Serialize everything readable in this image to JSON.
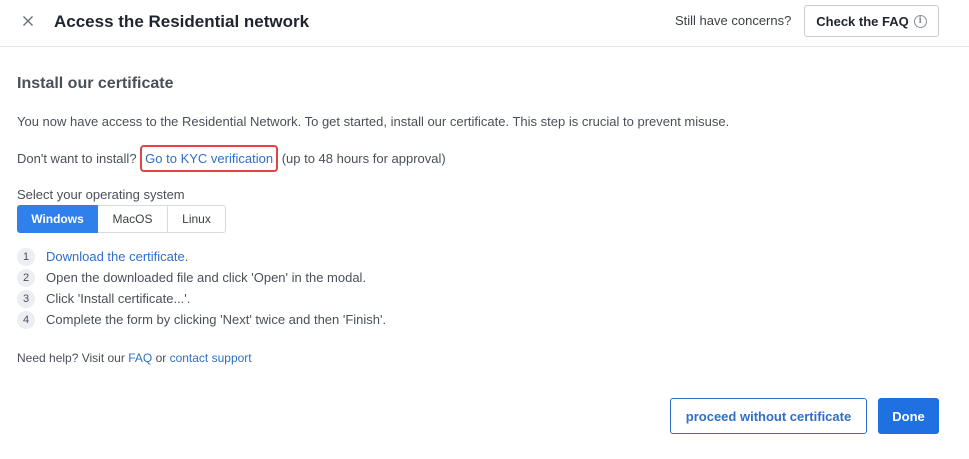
{
  "header": {
    "title": "Access the Residential network",
    "concerns_text": "Still have concerns?",
    "faq_button_label": "Check the FAQ",
    "info_glyph": "i"
  },
  "main": {
    "section_title": "Install our certificate",
    "intro": "You now have access to the Residential Network. To get started, install our certificate. This step is crucial to prevent misuse.",
    "kyc_prefix": "Don't want to install?",
    "kyc_link": "Go to KYC verification",
    "kyc_suffix": "(up to 48 hours for approval)",
    "os_label": "Select your operating system",
    "os_tabs": [
      {
        "label": "Windows",
        "selected": true
      },
      {
        "label": "MacOS",
        "selected": false
      },
      {
        "label": "Linux",
        "selected": false
      }
    ],
    "steps": [
      {
        "num": "1",
        "text": "Download the certificate."
      },
      {
        "num": "2",
        "text": "Open the downloaded file and click 'Open' in the modal."
      },
      {
        "num": "3",
        "text": "Click 'Install certificate...'."
      },
      {
        "num": "4",
        "text": "Complete the form by clicking 'Next' twice and then 'Finish'."
      }
    ],
    "help": {
      "prefix": "Need help? Visit our",
      "faq_link": "FAQ",
      "or": "or",
      "support_link": "contact support"
    }
  },
  "footer": {
    "proceed_label": "proceed without certificate",
    "done_label": "Done"
  },
  "colors": {
    "accent": "#2f80ed",
    "link": "#2f6fc7",
    "highlight_border": "#e24444"
  }
}
